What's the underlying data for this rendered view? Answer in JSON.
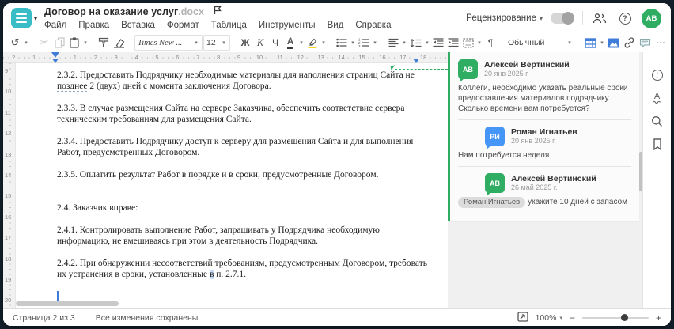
{
  "colors": {
    "teal": "#38bdc6",
    "green": "#2fae63",
    "blue": "#4596f7",
    "accent_blue": "#3f7dd8",
    "highlight_yellow": "#f5d327"
  },
  "header": {
    "title": "Договор на оказание услуг",
    "extension": ".docx",
    "review_label": "Рецензирование",
    "avatar_initials": "АВ"
  },
  "menu": {
    "items": [
      "Файл",
      "Правка",
      "Вставка",
      "Формат",
      "Таблица",
      "Инструменты",
      "Вид",
      "Справка"
    ]
  },
  "toolbar": {
    "font_name": "Times New ...",
    "font_size": "12",
    "bold_label": "Ж",
    "italic_label": "К",
    "underline_label": "Ч",
    "font_color_label": "А",
    "style_name": "Обычный",
    "pilcrow": "¶"
  },
  "icons": {
    "undo": "↺",
    "scissors": "✂",
    "ellipsis": "⋯",
    "caret": "▾",
    "minus": "−",
    "plus": "+",
    "question": "?",
    "info": "i",
    "spell_letter": "А"
  },
  "ruler": {
    "horizontal_numbers": [
      -2,
      -1,
      1,
      2,
      3,
      4,
      5,
      6,
      7,
      8,
      9,
      10,
      11,
      12,
      13,
      14,
      15,
      16,
      17,
      18
    ],
    "vertical_numbers": [
      9,
      10,
      11,
      12,
      13,
      14,
      15,
      16,
      17,
      18,
      19,
      20
    ]
  },
  "document": {
    "paragraphs": [
      {
        "runs": [
          {
            "t": "2.3.2. Предоставить Подрядчику необходимые материалы для наполнения страниц Сайта не"
          },
          {
            "br": true
          },
          {
            "t": "позднее",
            "cls": "dash-u"
          },
          {
            "t": " 2 (двух) дней с момента заключения Договора."
          }
        ]
      },
      {
        "runs": [
          {
            "t": "2.3.3. В случае размещения Сайта на сервере Заказчика, обеспечить соответствие сервера"
          },
          {
            "br": true
          },
          {
            "t": "техническим требованиям для размещения Сайта."
          }
        ]
      },
      {
        "runs": [
          {
            "t": "2.3.4. Предоставить Подрядчику доступ к серверу для размещения Сайта и для выполнения"
          },
          {
            "br": true
          },
          {
            "t": "Работ, предусмотренных Договором."
          }
        ]
      },
      {
        "runs": [
          {
            "t": "2.3.5. Оплатить результат Работ в порядке и в сроки, предусмотренные Договором."
          }
        ]
      },
      {
        "gap_before": true,
        "runs": [
          {
            "t": "2.4. Заказчик вправе:"
          }
        ]
      },
      {
        "runs": [
          {
            "t": "2.4.1. Контролировать выполнение Работ, запрашивать у Подрядчика необходимую"
          },
          {
            "br": true
          },
          {
            "t": "информацию, не вмешиваясь при этом в деятельность Подрядчика."
          }
        ]
      },
      {
        "runs": [
          {
            "t": "2.4.2. При обнаружении несоответствий требованиям, предусмотренным Договором, требовать"
          },
          {
            "br": true
          },
          {
            "t": "их устранения в сроки, установленные "
          },
          {
            "t": "в",
            "cls": "sel-hl"
          },
          {
            "t": " п. 2.7.1."
          }
        ]
      }
    ]
  },
  "comments": {
    "thread": [
      {
        "initials": "АВ",
        "name": "Алексей Вертинский",
        "date": "20 янв 2025 г.",
        "color": "green",
        "reply": false,
        "text": "Коллеги, необходимо указать реальные сроки предоставления материалов подрядчику. Сколько времени вам потребуется?"
      },
      {
        "initials": "РИ",
        "name": "Роман Игнатьев",
        "date": "20 янв 2025 г.",
        "color": "blue",
        "reply": true,
        "text": "Нам потребуется неделя"
      },
      {
        "initials": "АВ",
        "name": "Алексей Вертинский",
        "date": "26 май 2025 г.",
        "color": "green",
        "reply": true,
        "mention": "Роман Игнатьев",
        "text": "укажите 10 дней с запасом"
      }
    ]
  },
  "status_bar": {
    "page_info": "Страница 2 из 3",
    "save_status": "Все изменения сохранены",
    "zoom_value": "100%"
  }
}
